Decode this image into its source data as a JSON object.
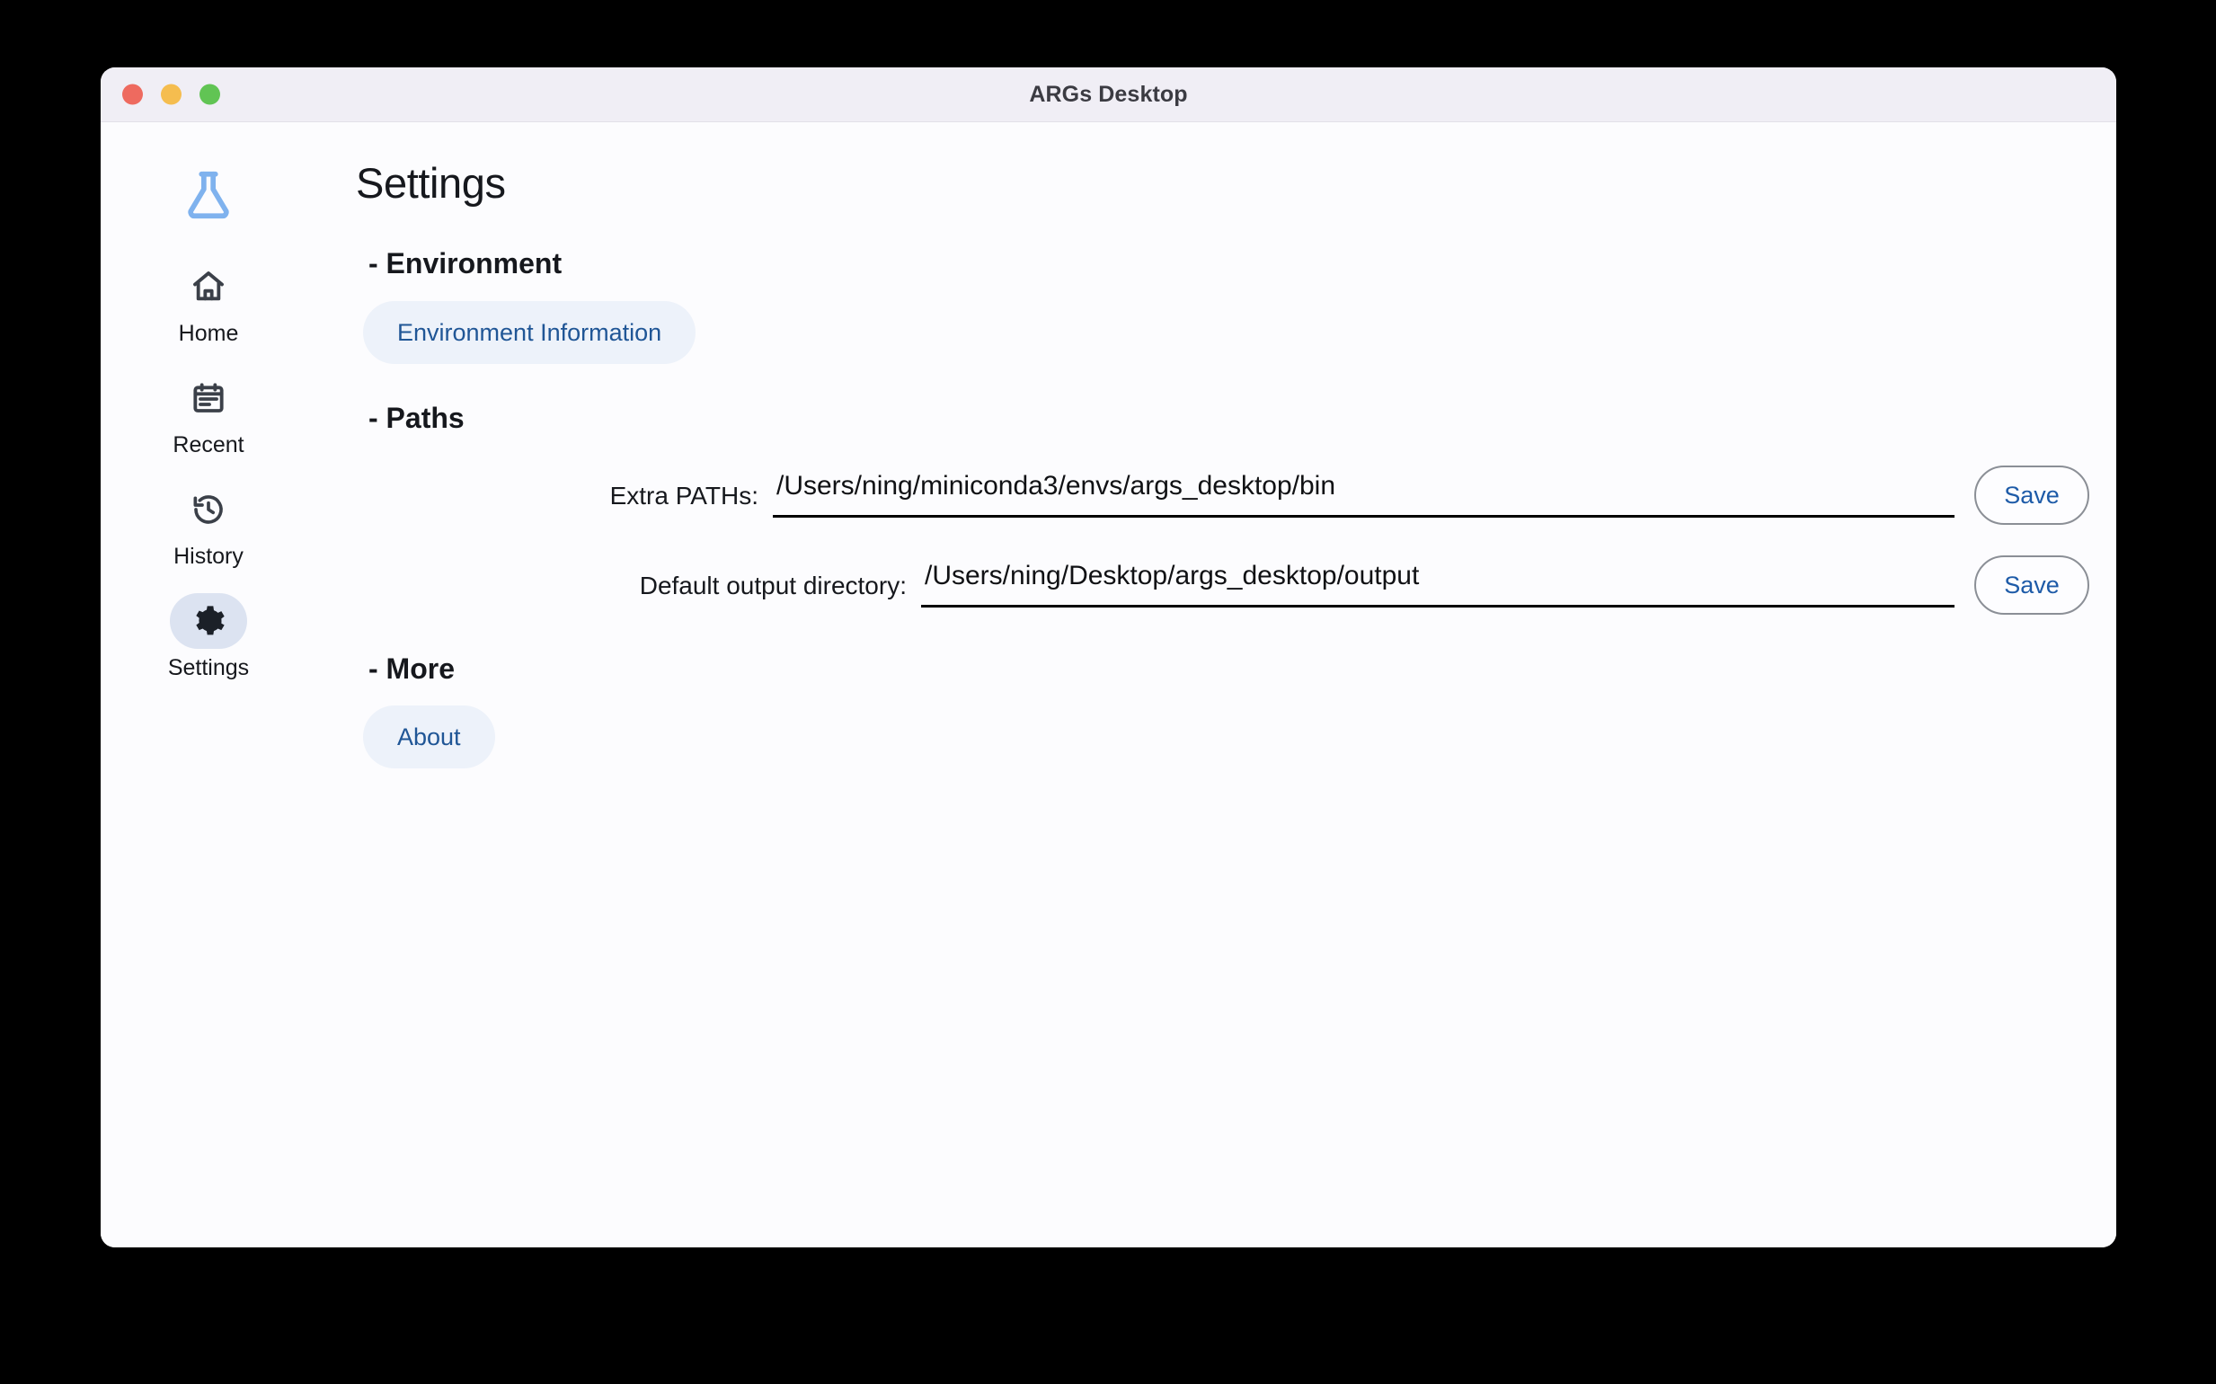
{
  "window": {
    "title": "ARGs Desktop",
    "traffic_lights": [
      {
        "name": "close",
        "color": "#ee6a5f"
      },
      {
        "name": "minimize",
        "color": "#f5bd4f"
      },
      {
        "name": "maximize",
        "color": "#61c454"
      }
    ]
  },
  "sidebar": {
    "logo_icon": "flask-icon",
    "logo_color": "#7fb2ee",
    "items": [
      {
        "label": "Home",
        "icon": "home-icon",
        "active": false
      },
      {
        "label": "Recent",
        "icon": "calendar-icon",
        "active": false
      },
      {
        "label": "History",
        "icon": "history-icon",
        "active": false
      },
      {
        "label": "Settings",
        "icon": "gear-icon",
        "active": true
      }
    ]
  },
  "main": {
    "page_title": "Settings",
    "sections": {
      "environment": {
        "heading": "- Environment",
        "button_label": "Environment Information"
      },
      "paths": {
        "heading": "- Paths",
        "fields": [
          {
            "label": "Extra PATHs:",
            "value": "/Users/ning/miniconda3/envs/args_desktop/bin",
            "placeholder": "",
            "save_label": "Save"
          },
          {
            "label": "Default output directory:",
            "value": "/Users/ning/Desktop/args_desktop/output",
            "placeholder": "",
            "save_label": "Save"
          }
        ]
      },
      "more": {
        "heading": "- More",
        "button_label": "About"
      }
    }
  },
  "colors": {
    "accent_blue": "#205696",
    "chip_bg": "#edf2fa",
    "active_pill": "#dce3f1",
    "titlebar_bg": "#f0eef5",
    "content_bg": "#fcfcfe",
    "divider": "#ced3dc"
  }
}
